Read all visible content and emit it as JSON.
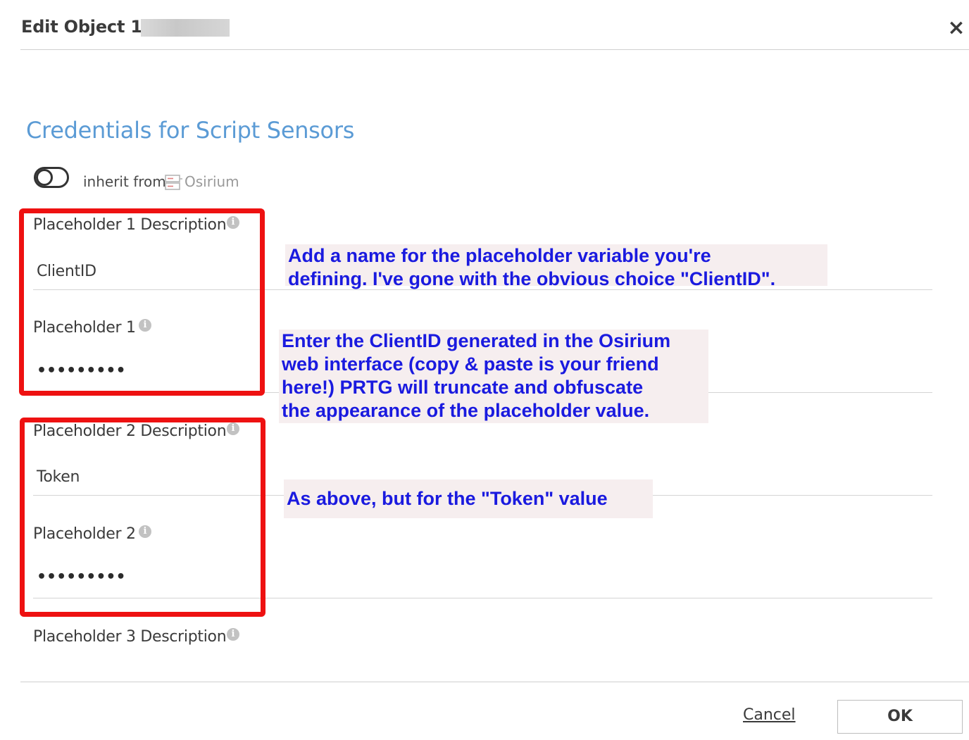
{
  "dialog": {
    "title": "Edit Object 10",
    "close_symbol": "×"
  },
  "section": {
    "title": "Credentials for Script Sensors"
  },
  "inherit": {
    "toggle_state": "off",
    "label": "inherit from",
    "icon": "group-icon",
    "source": "Osirium"
  },
  "fields": [
    {
      "label": "Placeholder 1 Description",
      "value": "ClientID",
      "type": "text"
    },
    {
      "label": "Placeholder 1",
      "value": "•••••••••",
      "type": "password"
    },
    {
      "label": "Placeholder 2 Description",
      "value": "Token",
      "type": "text"
    },
    {
      "label": "Placeholder 2",
      "value": "•••••••••",
      "type": "password"
    },
    {
      "label": "Placeholder 3 Description",
      "value": "",
      "type": "text"
    }
  ],
  "info_icon_glyph": "i",
  "annotations": {
    "callout_1": "Add a name for the placeholder variable you're\ndefining. I've gone with the obvious choice \"ClientID\".",
    "callout_2": "Enter the ClientID generated in the Osirium\nweb interface (copy & paste is your friend\nhere!) PRTG will truncate and obfuscate\nthe appearance of the placeholder value.",
    "callout_3": "As above, but for the \"Token\" value",
    "text_color": "#1a1adf",
    "background_color": "#f6eeef",
    "highlight_color": "#ee1111"
  },
  "footer": {
    "cancel_label": "Cancel",
    "ok_label": "OK"
  },
  "colors": {
    "section_title": "#5b9bd5",
    "text": "#3b3b3b"
  }
}
